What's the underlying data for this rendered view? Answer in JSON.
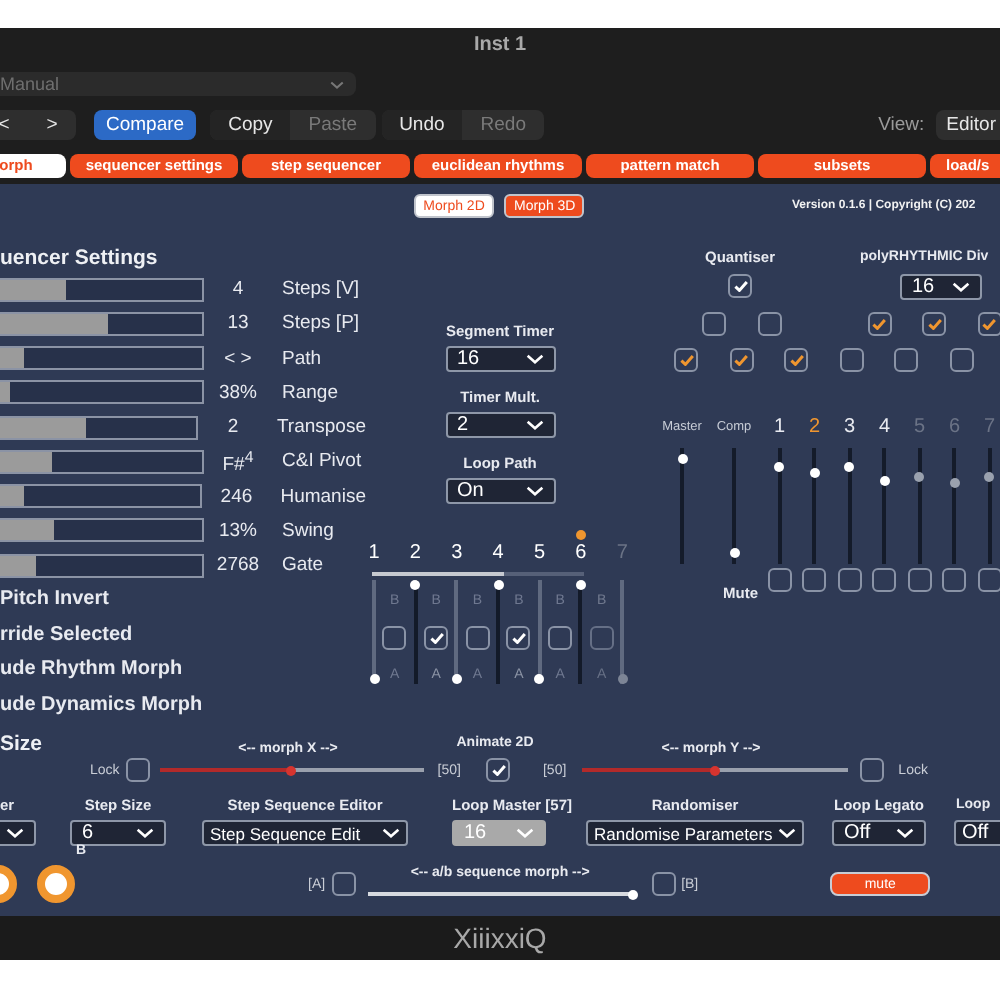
{
  "window": {
    "title": "Inst 1"
  },
  "preset": {
    "value": "Manual"
  },
  "toolbar": {
    "groups": [
      {
        "kind": "segmented",
        "buttons": [
          {
            "label": "<",
            "disabled": false
          },
          {
            "label": ">",
            "disabled": false
          }
        ]
      },
      {
        "kind": "accent",
        "buttons": [
          {
            "label": "Compare",
            "disabled": false
          }
        ]
      },
      {
        "kind": "segmented",
        "buttons": [
          {
            "label": "Copy",
            "disabled": false
          },
          {
            "label": "Paste",
            "disabled": true
          }
        ]
      },
      {
        "kind": "segmented",
        "buttons": [
          {
            "label": "Undo",
            "disabled": false
          },
          {
            "label": "Redo",
            "disabled": true
          }
        ]
      }
    ],
    "view_label": "View:",
    "view_value": "Editor"
  },
  "tabs": [
    {
      "label": "orph",
      "selected": true
    },
    {
      "label": "sequencer settings",
      "selected": false
    },
    {
      "label": "step sequencer",
      "selected": false
    },
    {
      "label": "euclidean rhythms",
      "selected": false
    },
    {
      "label": "pattern match",
      "selected": false
    },
    {
      "label": "subsets",
      "selected": false
    },
    {
      "label": "load/s",
      "selected": false
    }
  ],
  "subtabs": [
    {
      "label": "Morph 2D",
      "selected": true
    },
    {
      "label": "Morph 3D",
      "selected": false
    }
  ],
  "version": "Version 0.1.6 | Copyright (C) 202",
  "sequencer_settings": {
    "heading": "uencer Settings",
    "params": [
      {
        "level": 0.33,
        "value": "4",
        "label": "Steps [V]"
      },
      {
        "level": 0.53,
        "value": "13",
        "label": "Steps [P]"
      },
      {
        "level": 0.12,
        "value": "< >",
        "label": "Path"
      },
      {
        "level": 0.05,
        "value": "38%",
        "label": "Range"
      },
      {
        "level": 0.44,
        "value": "2",
        "label": "Transpose"
      },
      {
        "level": 0.26,
        "value": "F#$^{4}$",
        "label": "C&I Pivot"
      },
      {
        "level": 0.12,
        "value": "246",
        "label": "Humanise"
      },
      {
        "level": 0.27,
        "value": "13%",
        "label": "Swing"
      },
      {
        "level": 0.18,
        "value": "2768",
        "label": "Gate"
      }
    ]
  },
  "options": [
    "Pitch Invert",
    "rride Selected",
    "ude Rhythm Morph",
    "ude Dynamics Morph"
  ],
  "size_heading": "Size",
  "timers": [
    {
      "label": "Segment Timer",
      "value": "16"
    },
    {
      "label": "Timer Mult.",
      "value": "2"
    },
    {
      "label": "Loop Path",
      "value": "On"
    }
  ],
  "steps": {
    "level": 0.62,
    "numbers": [
      {
        "label": "1",
        "current": false,
        "disabled": false
      },
      {
        "label": "2",
        "current": false,
        "disabled": false
      },
      {
        "label": "3",
        "current": false,
        "disabled": false
      },
      {
        "label": "4",
        "current": false,
        "disabled": false
      },
      {
        "label": "5",
        "current": false,
        "disabled": false
      },
      {
        "label": "6",
        "current": true,
        "disabled": false
      },
      {
        "label": "7",
        "current": false,
        "disabled": true
      }
    ],
    "sliders": [
      {
        "level": 0,
        "disabled": false
      },
      {
        "level": 1,
        "disabled": false
      },
      {
        "level": 0,
        "disabled": false
      },
      {
        "level": 1,
        "disabled": false
      },
      {
        "level": 0,
        "disabled": false
      },
      {
        "level": 1,
        "disabled": false
      },
      {
        "level": 0,
        "disabled": true
      }
    ],
    "cells": [
      {
        "top": "B",
        "bottom": "A",
        "checked": false,
        "disabled": false
      },
      {
        "top": "B",
        "bottom": "A",
        "checked": true,
        "disabled": false
      },
      {
        "top": "B",
        "bottom": "A",
        "checked": false,
        "disabled": false
      },
      {
        "top": "B",
        "bottom": "A",
        "checked": true,
        "disabled": false
      },
      {
        "top": "B",
        "bottom": "A",
        "checked": false,
        "disabled": false
      },
      {
        "top": "B",
        "bottom": "A",
        "checked": false,
        "disabled": true
      }
    ]
  },
  "quantiser": {
    "label": "Quantiser",
    "checked": true,
    "upper": [
      {
        "checked": false
      },
      {
        "checked": false
      },
      {
        "checked": true
      },
      {
        "checked": true
      },
      {
        "checked": true
      }
    ],
    "lower": [
      {
        "checked": true
      },
      {
        "checked": true
      },
      {
        "checked": true
      },
      {
        "checked": false
      },
      {
        "checked": false
      },
      {
        "checked": false
      }
    ]
  },
  "poly": {
    "label": "polyRHYTHMIC Div",
    "value": "16"
  },
  "mixer": {
    "channels": [
      {
        "label": "Master",
        "level": 0.95,
        "selected": false,
        "disabled": false
      },
      {
        "label": "Comp",
        "level": 0.05,
        "selected": false,
        "disabled": false
      },
      {
        "label": "1",
        "level": 0.87,
        "selected": false,
        "disabled": false
      },
      {
        "label": "2",
        "level": 0.82,
        "selected": true,
        "disabled": false
      },
      {
        "label": "3",
        "level": 0.86,
        "selected": false,
        "disabled": false
      },
      {
        "label": "4",
        "level": 0.74,
        "selected": false,
        "disabled": false
      },
      {
        "label": "5",
        "level": 0.78,
        "selected": false,
        "disabled": true
      },
      {
        "label": "6",
        "level": 0.72,
        "selected": false,
        "disabled": true
      },
      {
        "label": "7",
        "level": 0.77,
        "selected": false,
        "disabled": true
      }
    ],
    "mute_label": "Mute",
    "mutes": [
      {
        "checked": false
      },
      {
        "checked": false
      },
      {
        "checked": false
      },
      {
        "checked": false
      },
      {
        "checked": false
      },
      {
        "checked": false
      },
      {
        "checked": false
      }
    ]
  },
  "morph": {
    "x": {
      "lock_label": "Lock",
      "lock": false,
      "title": "<-- morph X -->",
      "level": 0.5,
      "reading": "[50]"
    },
    "animate": {
      "label": "Animate 2D",
      "checked": true
    },
    "y": {
      "lock_label": "Lock",
      "lock": false,
      "title": "<-- morph Y -->",
      "level": 0.5,
      "reading": "[50]"
    }
  },
  "selectors": [
    {
      "label": "er",
      "disabled": false
    },
    {
      "label": "Step Size",
      "value": "6",
      "disabled": false
    },
    {
      "label": "Step Sequence Editor",
      "value": "Step Sequence Edit",
      "disabled": false
    },
    {
      "label": "Loop Master [57]",
      "value": "16",
      "disabled": true
    },
    {
      "label": "Randomiser",
      "value": "Randomise Parameters",
      "disabled": false
    },
    {
      "label": "Loop Legato",
      "value": "Off",
      "disabled": false
    },
    {
      "label": "Loop",
      "value": "Off",
      "disabled": false
    }
  ],
  "knobs": [
    {
      "kind": "ring"
    },
    {
      "kind": "ring",
      "label": "B"
    }
  ],
  "ab_morph": {
    "a_label": "[A]",
    "a_checked": false,
    "title": "<-- a/b sequence morph -->",
    "level": 1,
    "b_checked": false,
    "b_label": "[B]"
  },
  "mute_button": "mute",
  "footer": "XiiixxiQ"
}
